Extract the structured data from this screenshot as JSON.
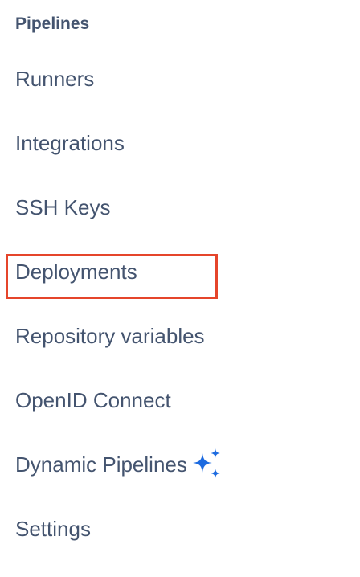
{
  "section": {
    "title": "Pipelines"
  },
  "nav": {
    "items": [
      {
        "label": "Runners"
      },
      {
        "label": "Integrations"
      },
      {
        "label": "SSH Keys"
      },
      {
        "label": "Deployments",
        "highlighted": true
      },
      {
        "label": "Repository variables"
      },
      {
        "label": "OpenID Connect"
      },
      {
        "label": "Dynamic Pipelines",
        "icon": "ai-sparkle-icon"
      },
      {
        "label": "Settings"
      }
    ]
  },
  "colors": {
    "text": "#44546f",
    "highlight_border": "#e5452b",
    "sparkle": "#1d6be0"
  }
}
